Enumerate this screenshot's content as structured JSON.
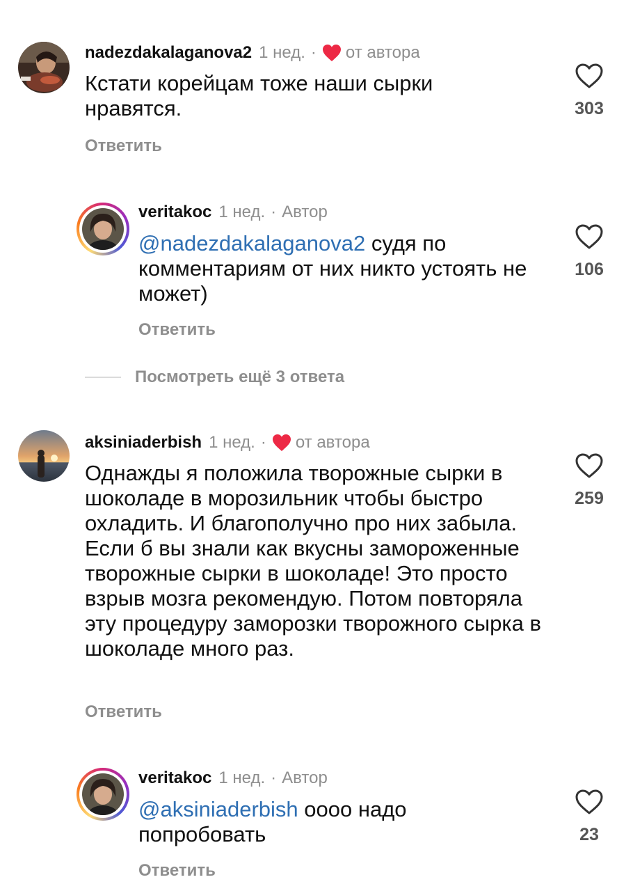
{
  "comments": [
    {
      "username": "nadezdakalaganova2",
      "time": "1 нед.",
      "separator": "·",
      "liked_by_author_label": "от автора",
      "text": "Кстати корейцам тоже наши сырки нравятся.",
      "reply_label": "Ответить",
      "likes": "303"
    },
    {
      "username": "veritakoc",
      "time": "1 нед.",
      "separator": "·",
      "author_label": "Автор",
      "mention": "@nadezdakalaganova2",
      "text": " судя по комментариям от них никто устоять не может)",
      "reply_label": "Ответить",
      "likes": "106"
    },
    {
      "username": "aksiniaderbish",
      "time": "1 нед.",
      "separator": "·",
      "liked_by_author_label": "от автора",
      "text": "Однажды я положила творожные сырки в шоколаде в морозильник чтобы быстро охладить. И благополучно про них забыла. Если б вы знали как вкусны замороженные творожные сырки в шоколаде! Это просто взрыв мозга рекомендую. Потом повторяла эту процедуру заморозки творожного сырка в шоколаде много раз.",
      "reply_label": "Ответить",
      "likes": "259"
    },
    {
      "username": "veritakoc",
      "time": "1 нед.",
      "separator": "·",
      "author_label": "Автор",
      "mention": "@aksiniaderbish",
      "text": " оооо надо попробовать",
      "reply_label": "Ответить",
      "likes": "23"
    }
  ],
  "view_more_replies": "Посмотреть ещё 3 ответа",
  "colors": {
    "heart_red": "#ed2945",
    "mention_blue": "#2f6fb3",
    "muted_gray": "#8e8e8e"
  },
  "icons": {
    "like": "heart-outline-icon",
    "author_like": "heart-filled-icon"
  }
}
